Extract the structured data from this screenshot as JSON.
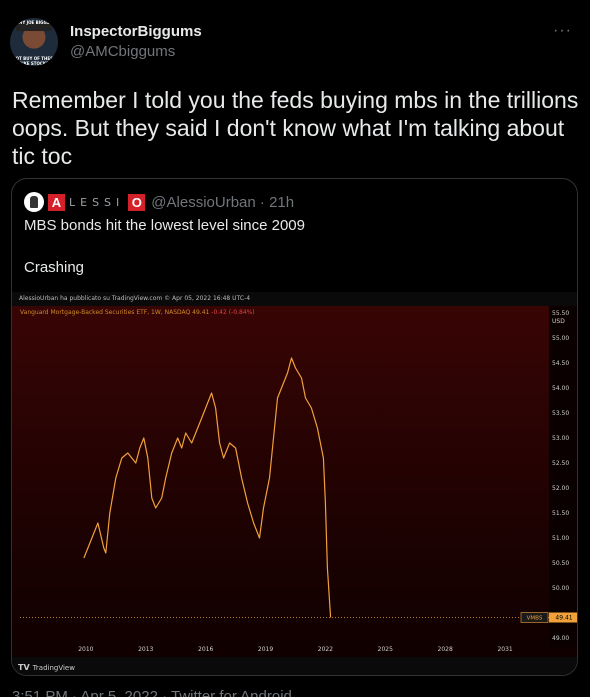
{
  "author": {
    "display_name": "InspectorBiggums",
    "handle": "@AMCbiggums",
    "avatar_top_text": "MY JOE BIGGS",
    "avatar_bottom_text": "HOT BUY OF THESE BIKE STOCKS"
  },
  "more_label": "···",
  "tweet_text": "Remember I told you the feds buying mbs in the trillions oops. But they said I don't know what I'm talking about tic toc",
  "quote": {
    "logo_left": "A",
    "logo_mid": "LESSI",
    "logo_right": "O",
    "handle_time": "@AlessioUrban · 21h",
    "line1": "MBS bonds hit the lowest level since 2009",
    "line2": "Crashing"
  },
  "chart": {
    "publisher_line": "AlessioUrban ha pubblicato su TradingView.com © Apr 05, 2022 16:48 UTC-4",
    "legend_prefix": "Vanguard Mortgage-Backed Securities ETF, 1W, NASDAQ",
    "legend_value": "49.41",
    "legend_change": "-0.42 (-0.84%)",
    "currency": "USD",
    "ticker": "VMBS",
    "last_value_label": "49.41",
    "branding": "TradingView",
    "branding_mark": "TV"
  },
  "chart_data": {
    "type": "line",
    "title": "Vanguard Mortgage-Backed Securities ETF, 1W, NASDAQ",
    "series": [
      {
        "name": "VMBS",
        "x": [
          2009.9,
          2010.2,
          2010.4,
          2010.6,
          2010.9,
          2011.0,
          2011.2,
          2011.5,
          2011.8,
          2012.1,
          2012.5,
          2012.7,
          2012.9,
          2013.1,
          2013.3,
          2013.5,
          2013.8,
          2014.0,
          2014.3,
          2014.6,
          2014.8,
          2015.0,
          2015.3,
          2015.6,
          2015.9,
          2016.1,
          2016.3,
          2016.5,
          2016.7,
          2016.9,
          2017.2,
          2017.5,
          2017.8,
          2018.1,
          2018.4,
          2018.7,
          2018.9,
          2019.2,
          2019.4,
          2019.6,
          2019.9,
          2020.1,
          2020.3,
          2020.5,
          2020.8,
          2021.0,
          2021.3,
          2021.6,
          2021.9,
          2022.0,
          2022.1,
          2022.26
        ],
        "values": [
          50.6,
          50.9,
          51.1,
          51.3,
          50.8,
          50.7,
          51.5,
          52.2,
          52.6,
          52.7,
          52.5,
          52.8,
          53.0,
          52.6,
          51.8,
          51.6,
          51.8,
          52.2,
          52.7,
          53.0,
          52.8,
          53.1,
          52.9,
          53.2,
          53.5,
          53.7,
          53.9,
          53.6,
          52.9,
          52.6,
          52.9,
          52.8,
          52.2,
          51.7,
          51.3,
          51.0,
          51.6,
          52.2,
          53.0,
          53.8,
          54.1,
          54.3,
          54.6,
          54.4,
          54.2,
          53.8,
          53.6,
          53.2,
          52.6,
          51.7,
          50.4,
          49.41
        ]
      }
    ],
    "x_ticks": [
      "2010",
      "2013",
      "2016",
      "2019",
      "2022",
      "2025",
      "2028",
      "2031"
    ],
    "y_ticks": [
      "55.00",
      "54.50",
      "54.00",
      "53.50",
      "53.00",
      "52.50",
      "52.00",
      "51.50",
      "51.00",
      "50.50",
      "50.00",
      "49.00"
    ],
    "top_tick": "55.50",
    "xlim": [
      2006.7,
      2033.2
    ],
    "ylim": [
      48.82,
      55.52
    ],
    "last_value": 49.41,
    "line_color": "#f0a13a",
    "grid": false
  },
  "footer_text": "3:51 PM · Apr 5, 2022 · Twitter for Android"
}
